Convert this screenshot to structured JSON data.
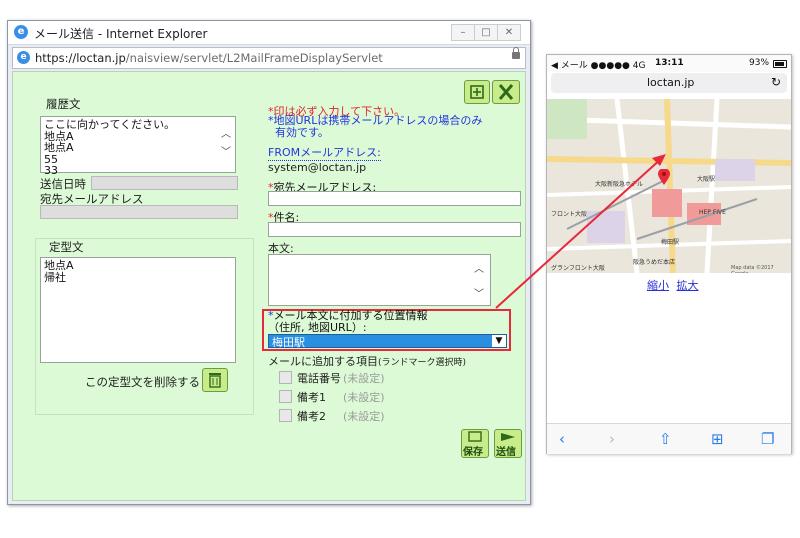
{
  "ie": {
    "title": "メール送信 - Internet Explorer",
    "url_host": "https://loctan.jp",
    "url_path": "/naisview/servlet/L2MailFrameDisplayServlet"
  },
  "left": {
    "history_label": "履歴文",
    "history_lines": "ここに向かってください。\n地点A\n地点A\n55\n33",
    "sent_datetime_label": "送信日時",
    "dest_address_label": "宛先メールアドレス",
    "template_label": "定型文",
    "template_lines": "地点A\n帰社",
    "delete_template_label": "この定型文を削除する"
  },
  "right": {
    "note_required": "*印は必ず入力して下さい。",
    "note_map_url": "*地図URLは携帯メールアドレスの場合のみ\n  有効です。",
    "from_label": "FROMメールアドレス:",
    "from_value": "system@loctan.jp",
    "to_label": "宛先メールアドレス:",
    "subject_label": "件名:",
    "body_label": "本文:",
    "location_label_line1": "メール本文に付加する位置情報",
    "location_label_line2": "（住所, 地図URL）:",
    "location_select": "梅田駅",
    "extra_items_label": "メールに追加する項目",
    "extra_items_note": "(ランドマーク選択時)",
    "options": [
      {
        "label": "電話番号",
        "value": "(未設定)"
      },
      {
        "label": "備考1",
        "value": "(未設定)"
      },
      {
        "label": "備考2",
        "value": "(未設定)"
      }
    ],
    "save_label": "保存",
    "send_label": "送信"
  },
  "phone": {
    "carrier": "◀ メール ●●●●● 4G",
    "time": "13:11",
    "battery": "93%",
    "host": "loctan.jp",
    "map_labels": {
      "a": "大阪新阪急ホテル",
      "b": "フロント大阪",
      "c": "梅田駅",
      "d": "阪急うめだ本店",
      "e": "HEP FIVE",
      "f": "大阪駅",
      "g": "グランフロント大阪",
      "h": "Map data ©2017 Google"
    },
    "zoom_out": "縮小",
    "zoom_in": "拡大"
  },
  "colors": {
    "panel_bg": "#ddfad7",
    "select_bg": "#2a8fe0",
    "highlight": "#e8283c",
    "link": "#2a2fd6"
  }
}
